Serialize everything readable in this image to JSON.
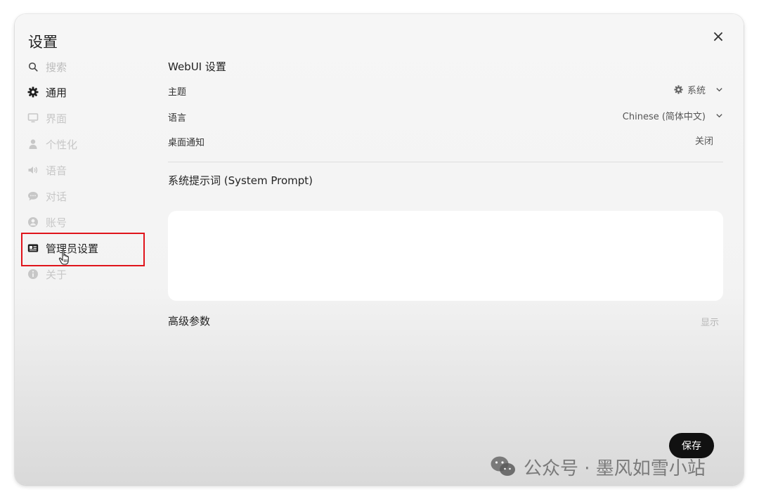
{
  "dialog": {
    "title": "设置",
    "close_label": "×"
  },
  "sidebar": {
    "search_placeholder": "搜索",
    "items": [
      {
        "label": "通用",
        "icon": "gear-icon"
      },
      {
        "label": "界面",
        "icon": "monitor-icon"
      },
      {
        "label": "个性化",
        "icon": "user-icon"
      },
      {
        "label": "语音",
        "icon": "speaker-icon"
      },
      {
        "label": "对话",
        "icon": "chat-bubble-icon"
      },
      {
        "label": "账号",
        "icon": "account-circle-icon"
      },
      {
        "label": "管理员设置",
        "icon": "id-card-icon"
      },
      {
        "label": "关于",
        "icon": "info-icon"
      }
    ]
  },
  "main": {
    "webui_title": "WebUI 设置",
    "theme": {
      "label": "主题",
      "value": "系统"
    },
    "language": {
      "label": "语言",
      "value": "Chinese (简体中文)"
    },
    "notifications": {
      "label": "桌面通知",
      "value": "关闭"
    },
    "system_prompt_title": "系统提示词 (System Prompt)",
    "system_prompt_value": "",
    "advanced_title": "高级参数",
    "advanced_toggle": "显示"
  },
  "save_label": "保存",
  "watermark": {
    "text": "公众号 · 墨风如雪小站",
    "icon": "wechat-icon"
  },
  "colors": {
    "highlight_border": "#e0141b",
    "save_button_bg": "#111111",
    "active_text": "#1f1f1f",
    "inactive_text": "#c7c7c7"
  }
}
